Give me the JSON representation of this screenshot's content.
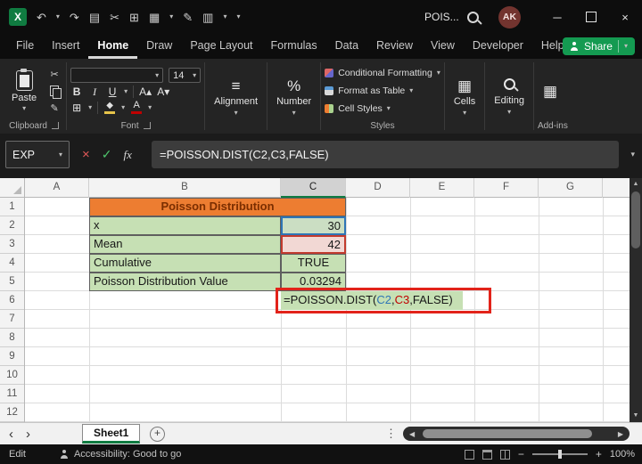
{
  "window": {
    "search_text": "POIS...",
    "avatar_initials": "AK"
  },
  "menu": {
    "items": [
      "File",
      "Insert",
      "Home",
      "Draw",
      "Page Layout",
      "Formulas",
      "Data",
      "Review",
      "View",
      "Developer",
      "Help"
    ],
    "share_label": "Share"
  },
  "ribbon": {
    "clipboard": {
      "group_label": "Clipboard",
      "paste_label": "Paste"
    },
    "font": {
      "group_label": "Font",
      "size_value": "14",
      "bold": "B",
      "italic": "I",
      "underline": "U"
    },
    "alignment": {
      "group_label": "Alignment"
    },
    "number": {
      "group_label": "Number"
    },
    "styles": {
      "group_label": "Styles",
      "conditional_formatting": "Conditional Formatting",
      "format_as_table": "Format as Table",
      "cell_styles": "Cell Styles"
    },
    "cells": {
      "button_label": "Cells"
    },
    "editing": {
      "button_label": "Editing"
    },
    "addins": {
      "group_label": "Add-ins"
    }
  },
  "formula_bar": {
    "name_box_value": "EXP",
    "fx_label": "fx",
    "formula": "=POISSON.DIST(C2,C3,FALSE)"
  },
  "sheet": {
    "columns": [
      "A",
      "B",
      "C",
      "D",
      "E",
      "F",
      "G"
    ],
    "rows": [
      "1",
      "2",
      "3",
      "4",
      "5",
      "6",
      "7",
      "8",
      "9",
      "10",
      "11",
      "12"
    ],
    "table": {
      "title": "Poisson Distribution",
      "x_label": "x",
      "x_value": "30",
      "mean_label": "Mean",
      "mean_value": "42",
      "cumulative_label": "Cumulative",
      "cumulative_value": "TRUE",
      "pdv_label": "Poisson Distribution Value",
      "pdv_value": "0.03294"
    },
    "formula_cell": {
      "part1": "=POISSON.DIST(",
      "ref1": "C2",
      "comma": ",",
      "ref2": "C3",
      "part2": ",FALSE)"
    }
  },
  "tab_bar": {
    "sheet_name": "Sheet1"
  },
  "status_bar": {
    "mode": "Edit",
    "accessibility": "Accessibility: Good to go",
    "zoom": "100%"
  },
  "colors": {
    "excel_green": "#107C41",
    "header_orange": "#ED7D31",
    "cell_green": "#C6E0B4",
    "annotation_red": "#E2231A",
    "ref_blue": "#2E75B6",
    "ref_red": "#C00000"
  }
}
